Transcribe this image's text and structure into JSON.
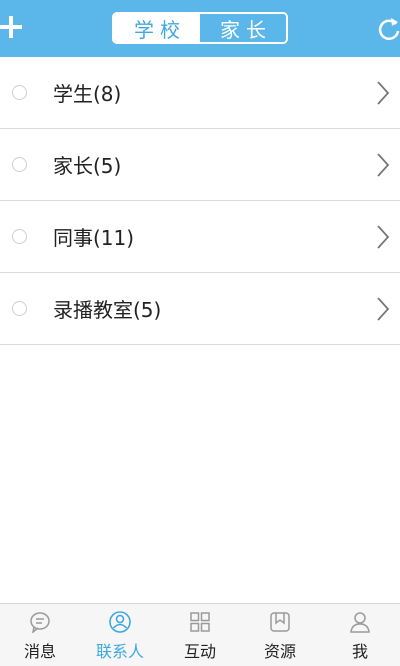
{
  "header": {
    "segments": [
      {
        "label": "学校",
        "active": true
      },
      {
        "label": "家长",
        "active": false
      }
    ],
    "add_icon": "plus-icon",
    "refresh_icon": "refresh-icon"
  },
  "list": {
    "items": [
      {
        "label": "学生(8)"
      },
      {
        "label": "家长(5)"
      },
      {
        "label": "同事(11)"
      },
      {
        "label": "录播教室(5)"
      }
    ]
  },
  "tabbar": {
    "tabs": [
      {
        "label": "消息",
        "icon": "message-bubble-icon",
        "active": false
      },
      {
        "label": "联系人",
        "icon": "contact-person-icon",
        "active": true
      },
      {
        "label": "互动",
        "icon": "grid-icon",
        "active": false
      },
      {
        "label": "资源",
        "icon": "bookmark-book-icon",
        "active": false
      },
      {
        "label": "我",
        "icon": "user-icon",
        "active": false
      }
    ]
  },
  "colors": {
    "header_bg": "#5bb7ea",
    "accent": "#3fa9df",
    "tab_inactive_icon": "#9a9a9a"
  }
}
